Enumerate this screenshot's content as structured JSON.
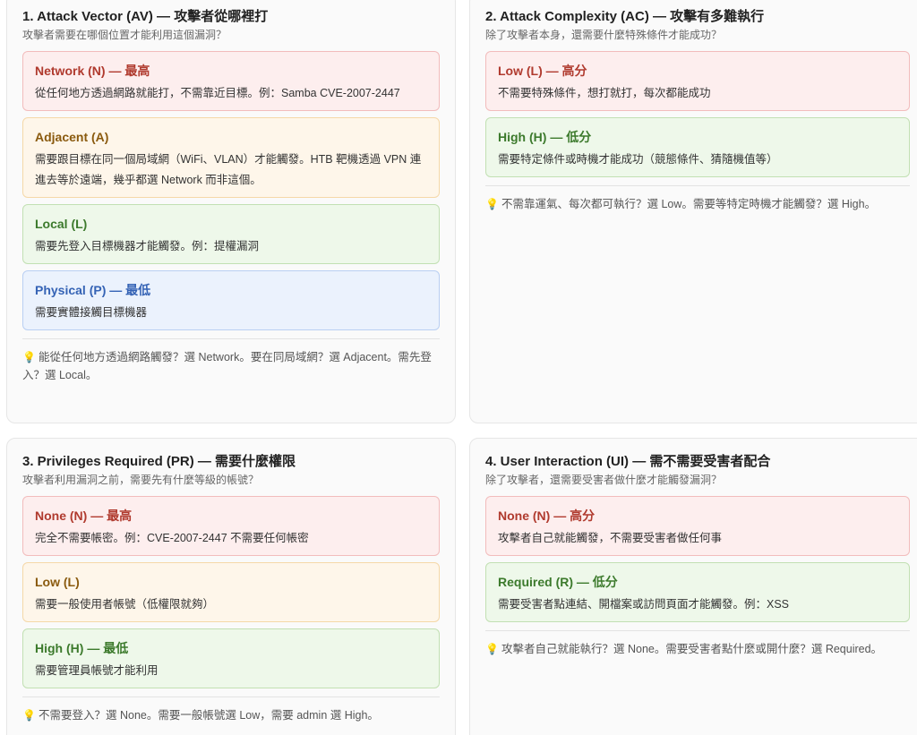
{
  "cards": [
    {
      "title": "1. Attack Vector (AV) — 攻擊者從哪裡打",
      "subtitle": "攻擊者需要在哪個位置才能利用這個漏洞？",
      "options": [
        {
          "name": "Network (N) — 最高",
          "desc": "從任何地方透過網路就能打，不需靠近目標。例：Samba CVE-2007-2447"
        },
        {
          "name": "Adjacent (A)",
          "desc": "需要跟目標在同一個局域網（WiFi、VLAN）才能觸發。HTB 靶機透過 VPN 連進去等於遠端，幾乎都選 Network 而非這個。"
        },
        {
          "name": "Local (L)",
          "desc": "需要先登入目標機器才能觸發。例：提權漏洞"
        },
        {
          "name": "Physical (P) — 最低",
          "desc": "需要實體接觸目標機器"
        }
      ],
      "tip": "能從任何地方透過網路觸發？選 Network。要在同局域網？選 Adjacent。需先登入？選 Local。"
    },
    {
      "title": "2. Attack Complexity (AC) — 攻擊有多難執行",
      "subtitle": "除了攻擊者本身，還需要什麼特殊條件才能成功？",
      "options": [
        {
          "name": "Low (L) — 高分",
          "desc": "不需要特殊條件，想打就打，每次都能成功"
        },
        {
          "name": "High (H) — 低分",
          "desc": "需要特定條件或時機才能成功（競態條件、猜隨機值等）"
        }
      ],
      "tip": "不需靠運氣、每次都可執行？選 Low。需要等特定時機才能觸發？選 High。"
    },
    {
      "title": "3. Privileges Required (PR) — 需要什麼權限",
      "subtitle": "攻擊者利用漏洞之前，需要先有什麼等級的帳號？",
      "options": [
        {
          "name": "None (N) — 最高",
          "desc": "完全不需要帳密。例：CVE-2007-2447 不需要任何帳密"
        },
        {
          "name": "Low (L)",
          "desc": "需要一般使用者帳號（低權限就夠）"
        },
        {
          "name": "High (H) — 最低",
          "desc": "需要管理員帳號才能利用"
        }
      ],
      "tip": "不需要登入？選 None。需要一般帳號選 Low，需要 admin 選 High。"
    },
    {
      "title": "4. User Interaction (UI) — 需不需要受害者配合",
      "subtitle": "除了攻擊者，還需要受害者做什麼才能觸發漏洞？",
      "options": [
        {
          "name": "None (N) — 高分",
          "desc": "攻擊者自己就能觸發，不需要受害者做任何事"
        },
        {
          "name": "Required (R) — 低分",
          "desc": "需要受害者點連結、開檔案或訪問頁面才能觸發。例：XSS"
        }
      ],
      "tip": "攻擊者自己就能執行？選 None。需要受害者點什麼或開什麼？選 Required。"
    }
  ],
  "colors": {
    "red": "#b03a2e",
    "orange": "#8a5a0e",
    "green": "#3c7a2c",
    "blue": "#3563b5",
    "bulb": "#e8b21c"
  },
  "icons": {
    "tip": "lightbulb-icon"
  }
}
